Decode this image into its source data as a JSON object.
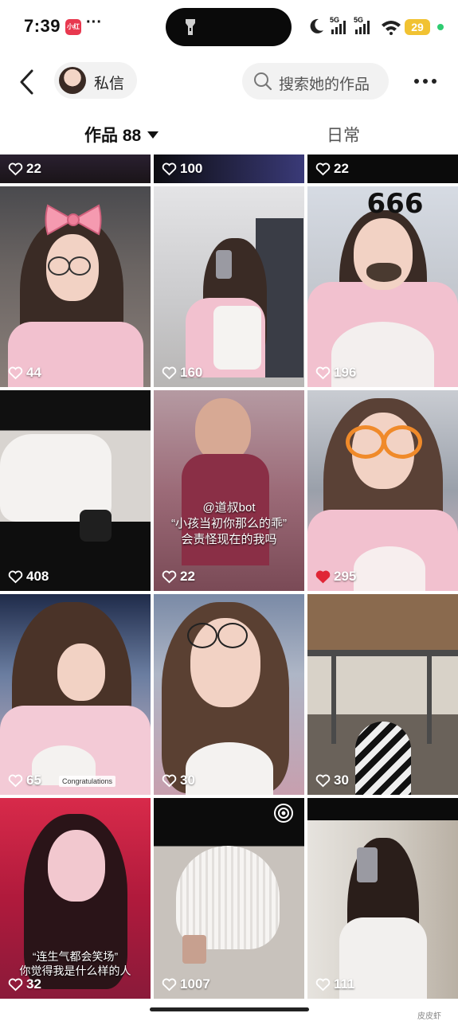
{
  "status_bar": {
    "time": "7:39",
    "app_badge": "小红书",
    "dots": "···",
    "signal_1": "5G",
    "signal_2": "5G",
    "battery": "29"
  },
  "header": {
    "message_label": "私信",
    "search_placeholder": "搜索她的作品"
  },
  "tabs": {
    "works_label": "作品",
    "works_count": "88",
    "daily_label": "日常"
  },
  "grid": {
    "cells": [
      {
        "likes": "22"
      },
      {
        "likes": "100"
      },
      {
        "likes": "22"
      },
      {
        "likes": "44"
      },
      {
        "likes": "160"
      },
      {
        "likes": "196"
      },
      {
        "likes": "408"
      },
      {
        "likes": "22"
      },
      {
        "likes": "295"
      },
      {
        "likes": "65"
      },
      {
        "likes": "30"
      },
      {
        "likes": "30"
      },
      {
        "likes": "32"
      },
      {
        "likes": "1007"
      },
      {
        "likes": "111"
      }
    ],
    "cell_8_caption": {
      "handle": "@道叔bot",
      "line1": "“小孩当初你那么的乖”",
      "line2": "会责怪现在的我吗"
    },
    "cell_10_overlay": "Congratulations",
    "cell_11_face_sticker": "666",
    "cell_13_caption": {
      "line1": "“连生气都会笑场”",
      "line2": "你觉得我是什么样的人"
    }
  },
  "watermark": "皮皮虾"
}
